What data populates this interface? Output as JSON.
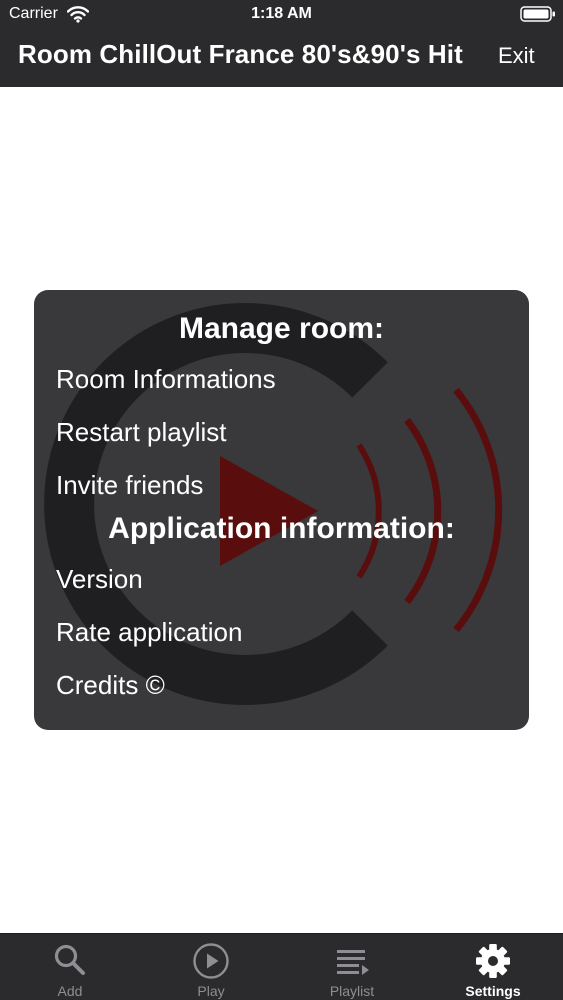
{
  "status_bar": {
    "carrier": "Carrier",
    "time": "1:18 AM"
  },
  "nav": {
    "title": "Room ChillOut France 80's&90's Hit",
    "exit_label": "Exit"
  },
  "panel": {
    "manage_title": "Manage room:",
    "manage_items": [
      "Room Informations",
      "Restart playlist",
      "Invite friends"
    ],
    "app_title": "Application information:",
    "app_items": [
      "Version",
      "Rate application",
      "Credits ©"
    ]
  },
  "tabs": [
    {
      "label": "Add",
      "icon": "search-icon",
      "active": false
    },
    {
      "label": "Play",
      "icon": "play-circle-icon",
      "active": false
    },
    {
      "label": "Playlist",
      "icon": "playlist-icon",
      "active": false
    },
    {
      "label": "Settings",
      "icon": "gear-icon",
      "active": true
    }
  ],
  "colors": {
    "bar_background": "#2b2b2d",
    "panel_background": "#39393b",
    "logo_dark": "#1f1f21",
    "logo_red": "#5a0d0d",
    "inactive_tab": "#8e8e93",
    "active_tab": "#ffffff"
  }
}
